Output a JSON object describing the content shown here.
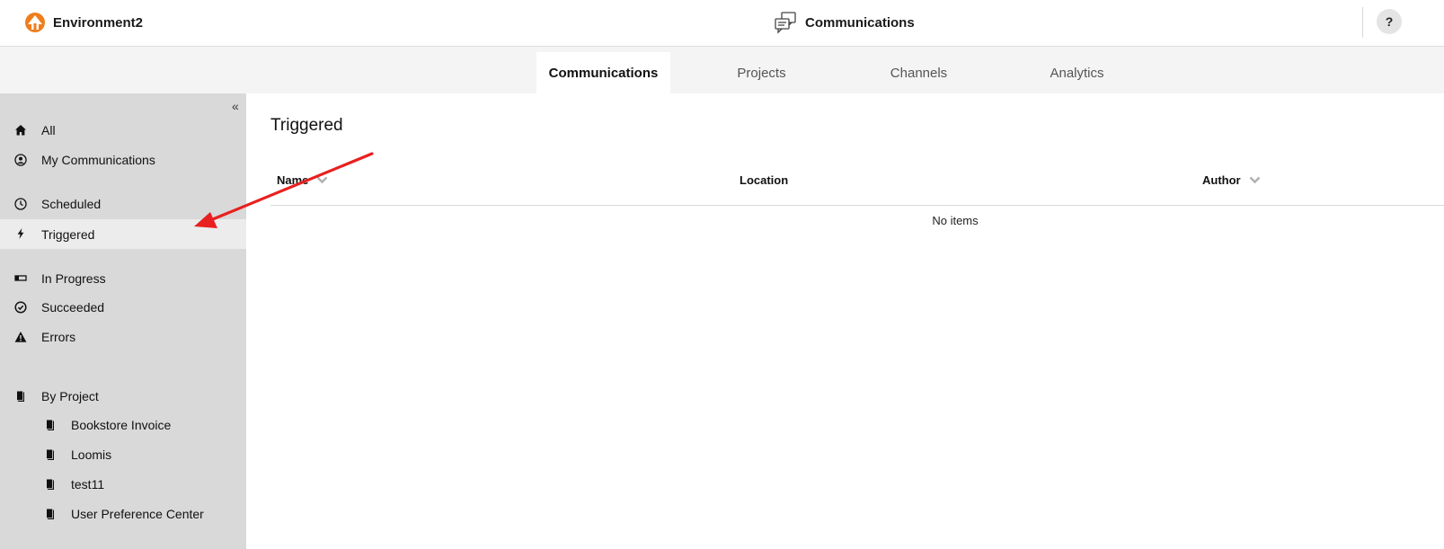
{
  "header": {
    "environment_name": "Environment2",
    "app_title": "Communications",
    "help_label": "?"
  },
  "tabs": [
    {
      "label": "Communications",
      "active": true
    },
    {
      "label": "Projects",
      "active": false
    },
    {
      "label": "Channels",
      "active": false
    },
    {
      "label": "Analytics",
      "active": false
    }
  ],
  "sidebar": {
    "collapse_label": "«",
    "items": [
      {
        "label": "All",
        "icon": "home-icon"
      },
      {
        "label": "My Communications",
        "icon": "user-circle-icon"
      },
      {
        "label": "Scheduled",
        "icon": "clock-icon"
      },
      {
        "label": "Triggered",
        "icon": "bolt-icon",
        "active": true
      },
      {
        "label": "In Progress",
        "icon": "progress-icon"
      },
      {
        "label": "Succeeded",
        "icon": "check-circle-icon"
      },
      {
        "label": "Errors",
        "icon": "warning-icon"
      },
      {
        "label": "By Project",
        "icon": "book-icon"
      }
    ],
    "projects": [
      {
        "label": "Bookstore Invoice",
        "icon": "book-icon"
      },
      {
        "label": "Loomis",
        "icon": "book-icon"
      },
      {
        "label": "test11",
        "icon": "book-icon"
      },
      {
        "label": "User Preference Center",
        "icon": "book-icon"
      }
    ]
  },
  "main": {
    "title": "Triggered",
    "columns": [
      {
        "label": "Name",
        "sortable": true
      },
      {
        "label": "Location",
        "sortable": false
      },
      {
        "label": "Author",
        "sortable": true
      }
    ],
    "empty_text": "No items"
  },
  "colors": {
    "brand_orange": "#ef7d1a",
    "sidebar_bg": "#d9d9d9",
    "active_item_bg": "#ececec",
    "annotation_arrow": "#e8201f"
  }
}
